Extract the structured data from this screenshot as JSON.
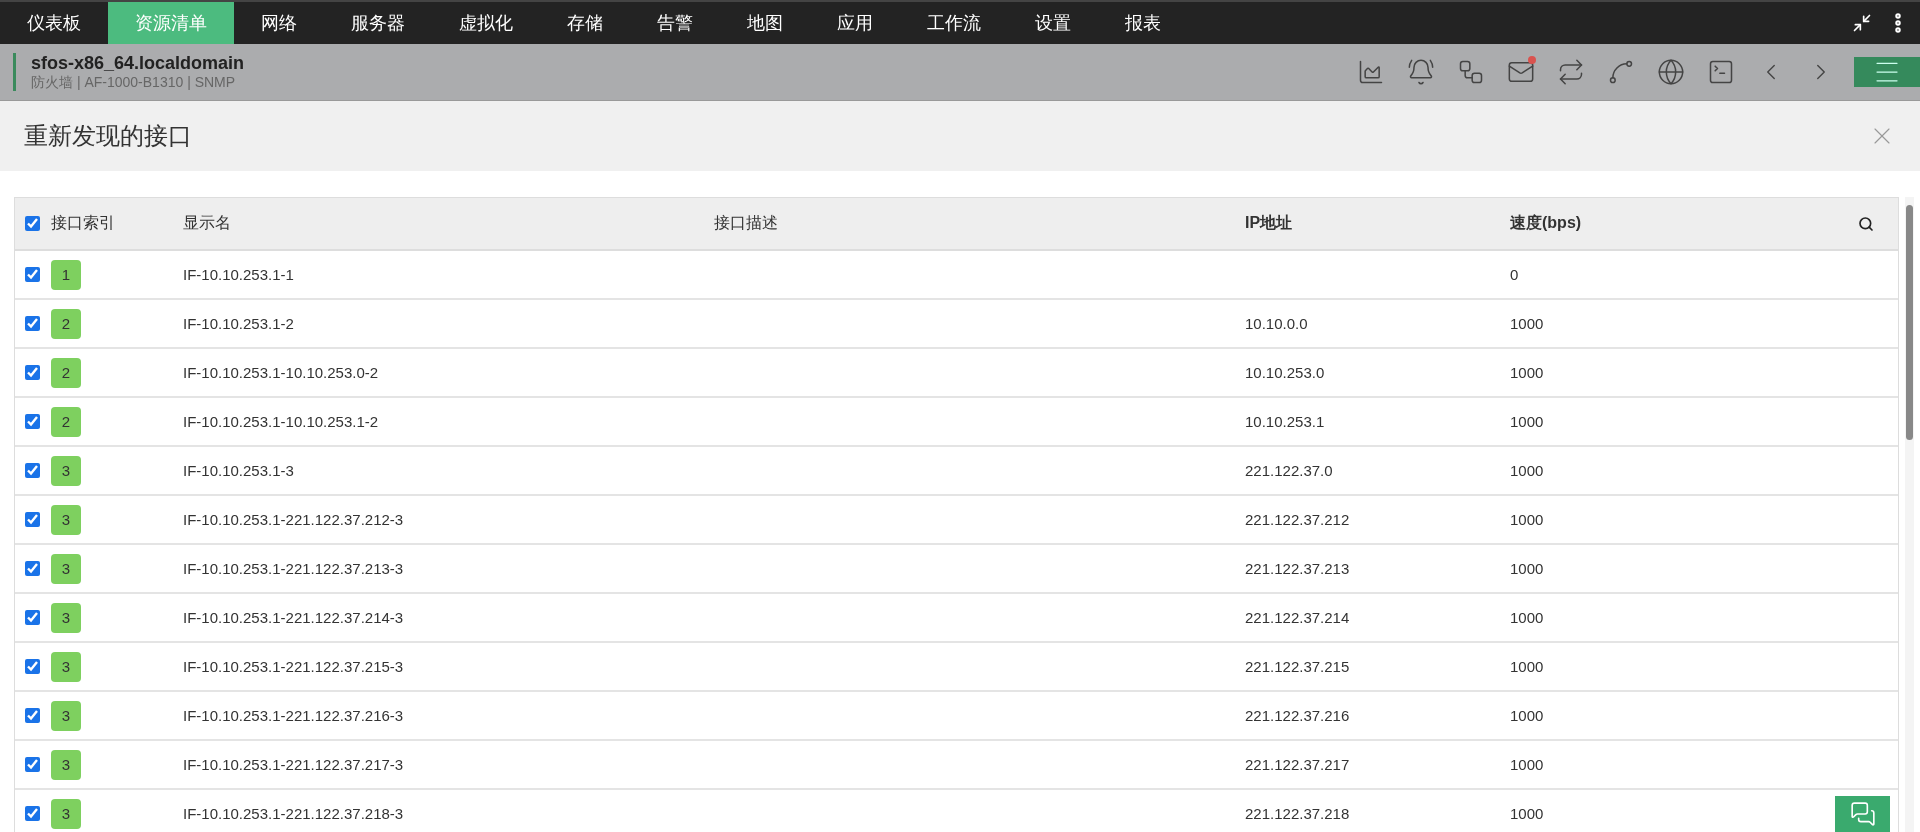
{
  "nav": {
    "items": [
      {
        "label": "仪表板",
        "selected": false
      },
      {
        "label": "资源清单",
        "selected": true
      },
      {
        "label": "网络",
        "selected": false
      },
      {
        "label": "服务器",
        "selected": false
      },
      {
        "label": "虚拟化",
        "selected": false
      },
      {
        "label": "存储",
        "selected": false
      },
      {
        "label": "告警",
        "selected": false
      },
      {
        "label": "地图",
        "selected": false
      },
      {
        "label": "应用",
        "selected": false
      },
      {
        "label": "工作流",
        "selected": false
      },
      {
        "label": "设置",
        "selected": false
      },
      {
        "label": "报表",
        "selected": false
      }
    ]
  },
  "device": {
    "name": "sfos-x86_64.localdomain",
    "details": "防火墙 | AF-1000-B1310  | SNMP"
  },
  "dialog": {
    "title": "重新发现的接口"
  },
  "table": {
    "select_all_checked": true,
    "columns": [
      "接口索引",
      "显示名",
      "接口描述",
      "IP地址",
      "速度(bps)"
    ],
    "rows": [
      {
        "checked": true,
        "index": "1",
        "name": "IF-10.10.253.1-1",
        "speed": "0"
      },
      {
        "checked": true,
        "index": "2",
        "name": "IF-10.10.253.1-2",
        "ip": "10.10.0.0",
        "speed": "1000"
      },
      {
        "checked": true,
        "index": "2",
        "name": "IF-10.10.253.1-10.10.253.0-2",
        "ip": "10.10.253.0",
        "speed": "1000"
      },
      {
        "checked": true,
        "index": "2",
        "name": "IF-10.10.253.1-10.10.253.1-2",
        "ip": "10.10.253.1",
        "speed": "1000"
      },
      {
        "checked": true,
        "index": "3",
        "name": "IF-10.10.253.1-3",
        "ip": "221.122.37.0",
        "speed": "1000"
      },
      {
        "checked": true,
        "index": "3",
        "name": "IF-10.10.253.1-221.122.37.212-3",
        "ip": "221.122.37.212",
        "speed": "1000"
      },
      {
        "checked": true,
        "index": "3",
        "name": "IF-10.10.253.1-221.122.37.213-3",
        "ip": "221.122.37.213",
        "speed": "1000"
      },
      {
        "checked": true,
        "index": "3",
        "name": "IF-10.10.253.1-221.122.37.214-3",
        "ip": "221.122.37.214",
        "speed": "1000"
      },
      {
        "checked": true,
        "index": "3",
        "name": "IF-10.10.253.1-221.122.37.215-3",
        "ip": "221.122.37.215",
        "speed": "1000"
      },
      {
        "checked": true,
        "index": "3",
        "name": "IF-10.10.253.1-221.122.37.216-3",
        "ip": "221.122.37.216",
        "speed": "1000"
      },
      {
        "checked": true,
        "index": "3",
        "name": "IF-10.10.253.1-221.122.37.217-3",
        "ip": "221.122.37.217",
        "speed": "1000"
      },
      {
        "checked": true,
        "index": "3",
        "name": "IF-10.10.253.1-221.122.37.218-3",
        "ip": "221.122.37.218",
        "speed": "1000"
      }
    ]
  }
}
